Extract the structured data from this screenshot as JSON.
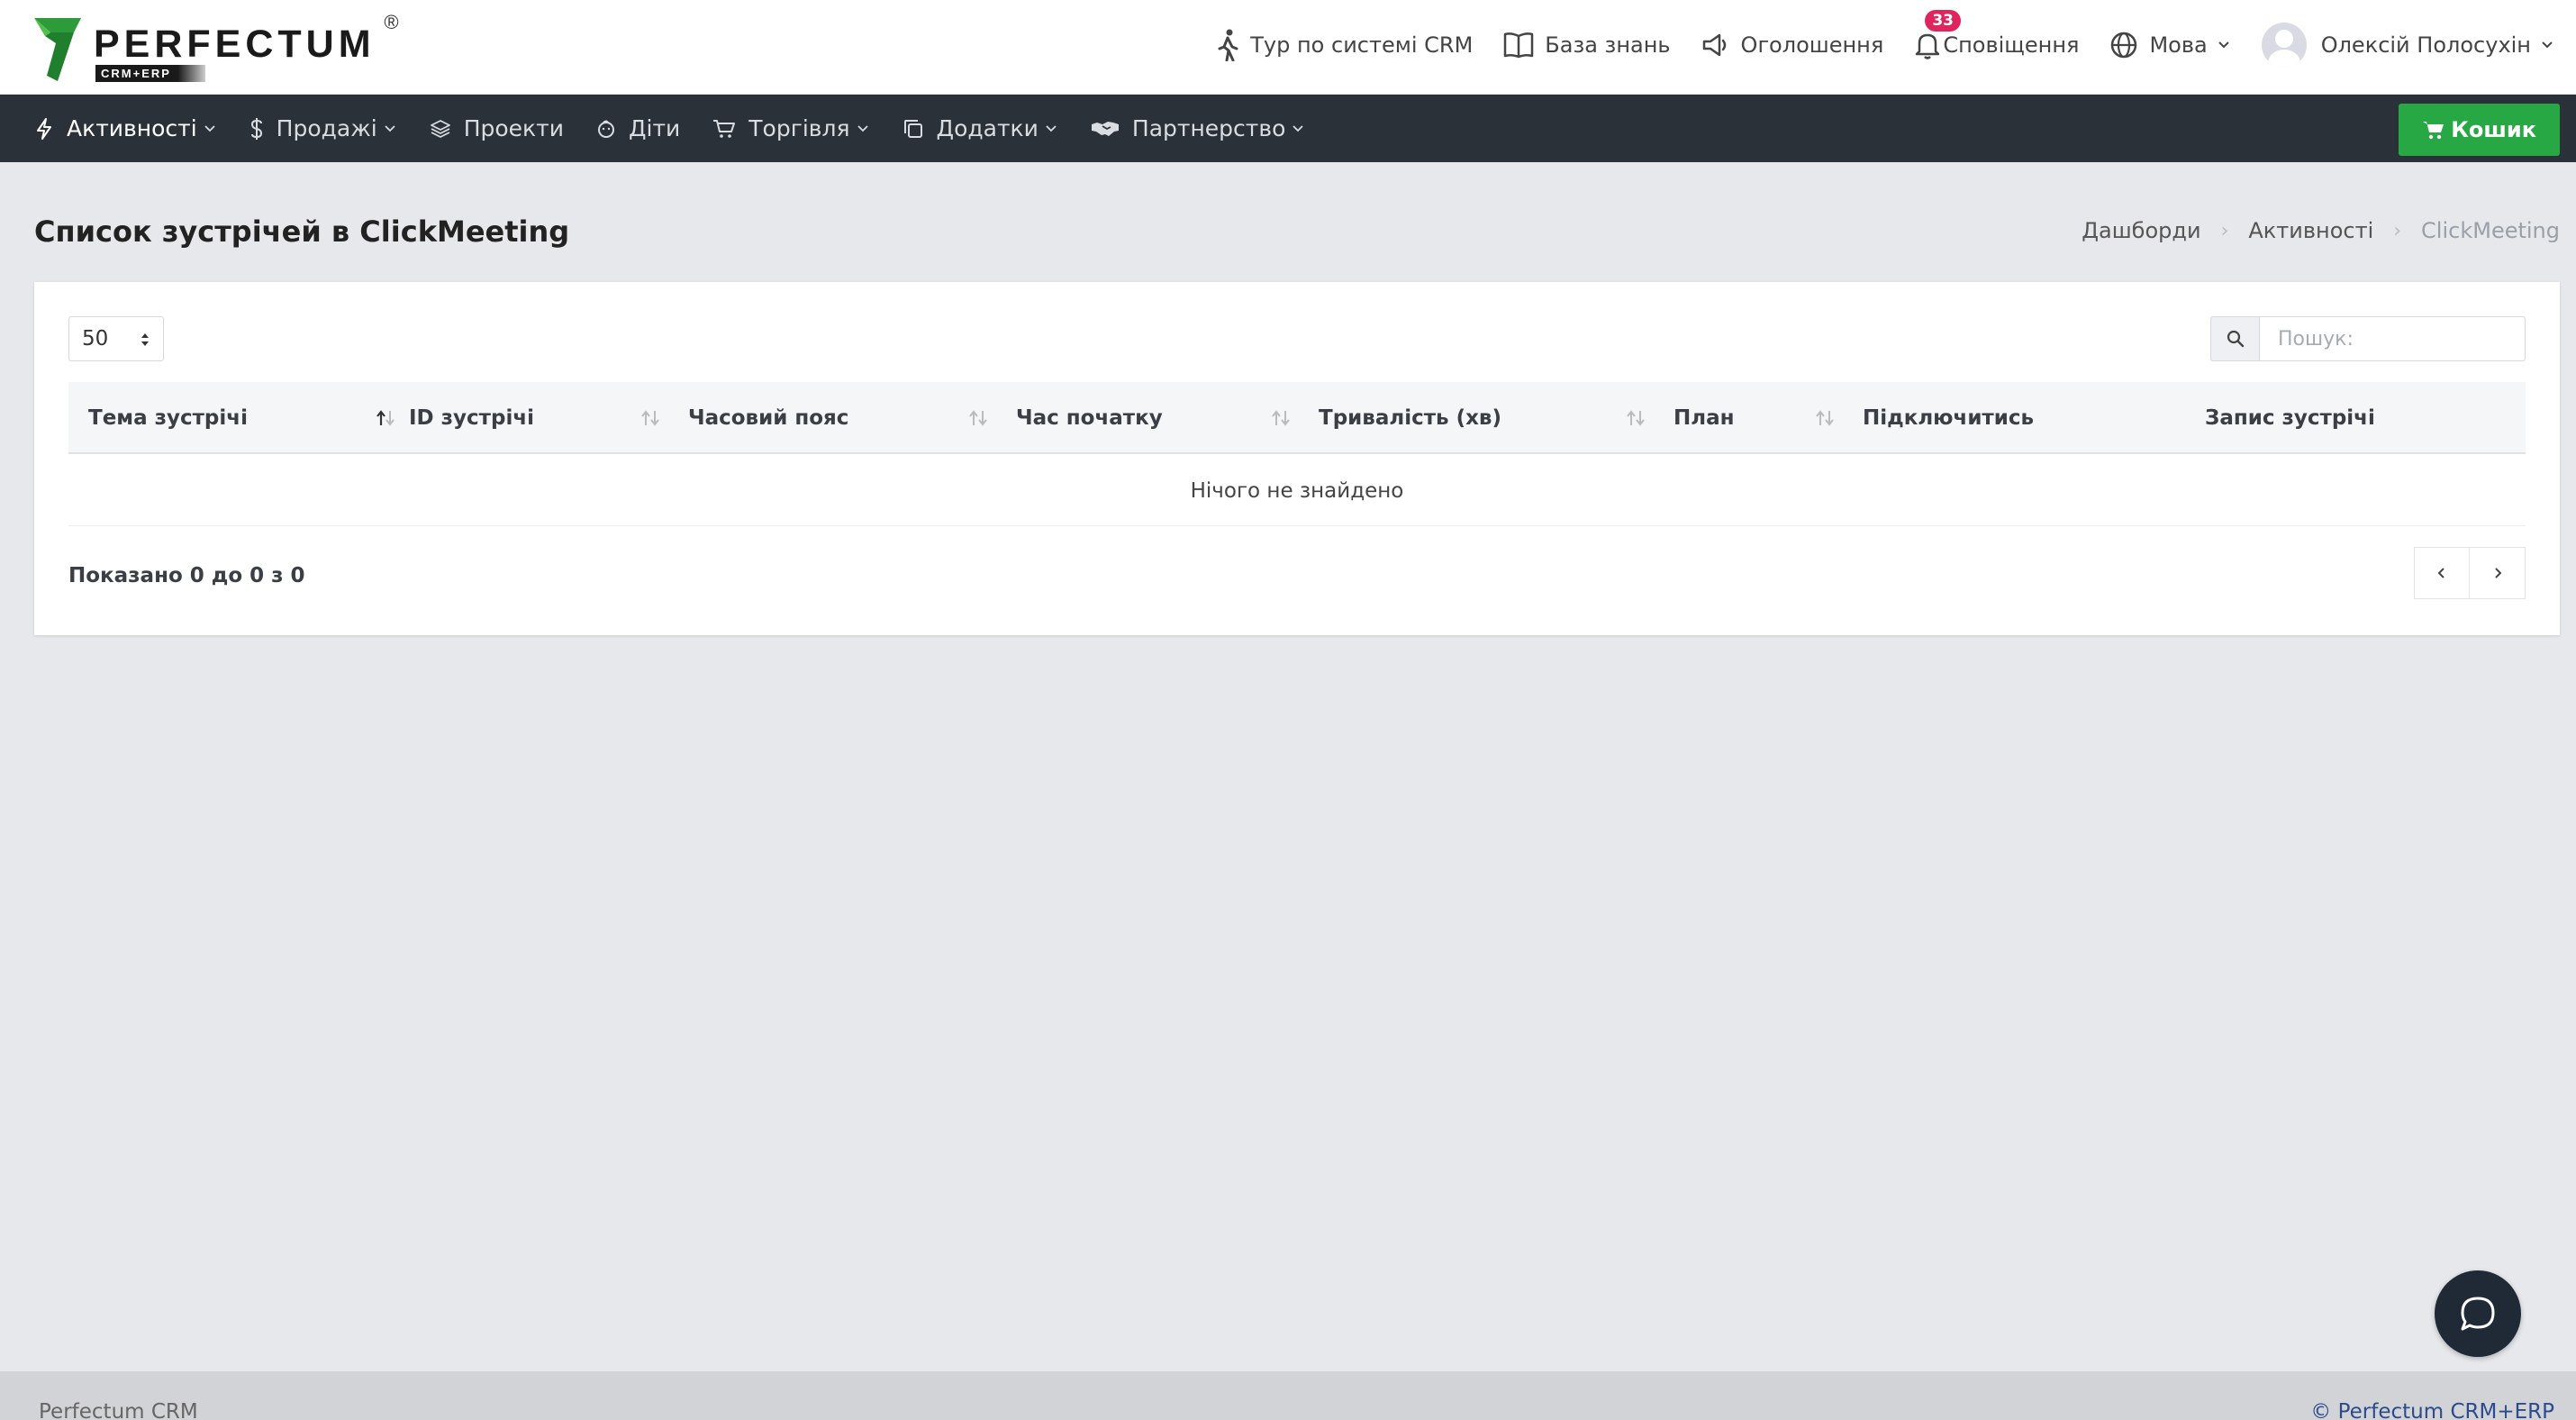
{
  "brand": {
    "name": "PERFECTUM",
    "sub": "CRM+ERP",
    "reg": "®"
  },
  "header": {
    "items": [
      {
        "label": "Тур по системі CRM",
        "icon": "walking-person-icon"
      },
      {
        "label": "База знань",
        "icon": "book-icon"
      },
      {
        "label": "Оголошення",
        "icon": "megaphone-icon"
      },
      {
        "label": "Сповіщення",
        "icon": "bell-icon",
        "badge": "33"
      },
      {
        "label": "Мова",
        "icon": "globe-icon"
      },
      {
        "label": "Олексій Полосухін",
        "icon": "avatar"
      }
    ]
  },
  "mainnav": {
    "items": [
      {
        "label": "Активності",
        "icon": "bolt-icon",
        "dropdown": true,
        "active": true
      },
      {
        "label": "Продажі",
        "icon": "dollar-icon",
        "dropdown": true
      },
      {
        "label": "Проекти",
        "icon": "layers-icon",
        "dropdown": false
      },
      {
        "label": "Діти",
        "icon": "baby-icon",
        "dropdown": false
      },
      {
        "label": "Торгівля",
        "icon": "cart-outline-icon",
        "dropdown": true
      },
      {
        "label": "Додатки",
        "icon": "copy-icon",
        "dropdown": true
      },
      {
        "label": "Партнерство",
        "icon": "handshake-icon",
        "dropdown": true
      }
    ],
    "cart_label": "Кошик"
  },
  "page": {
    "title": "Список зустрічей в ClickMeeting",
    "breadcrumb": [
      "Дашборди",
      "Активності",
      "ClickMeeting"
    ]
  },
  "table": {
    "page_size": "50",
    "search_placeholder": "Пошук:",
    "columns": [
      "Тема зустрічі",
      "ID зустрічі",
      "Часовий пояс",
      "Час початку",
      "Тривалість (хв)",
      "План",
      "Підключитись",
      "Запис зустрічі"
    ],
    "empty_text": "Нічого не знайдено",
    "info": "Показано 0 до 0 з 0"
  },
  "footer": {
    "left": "Perfectum CRM",
    "right": "© Perfectum CRM+ERP"
  },
  "colors": {
    "navbar": "#2b3139",
    "cart_button": "#28a745",
    "badge": "#e0245e",
    "page_bg": "#e7e8ec",
    "logo_green": "#2e9b3a"
  }
}
